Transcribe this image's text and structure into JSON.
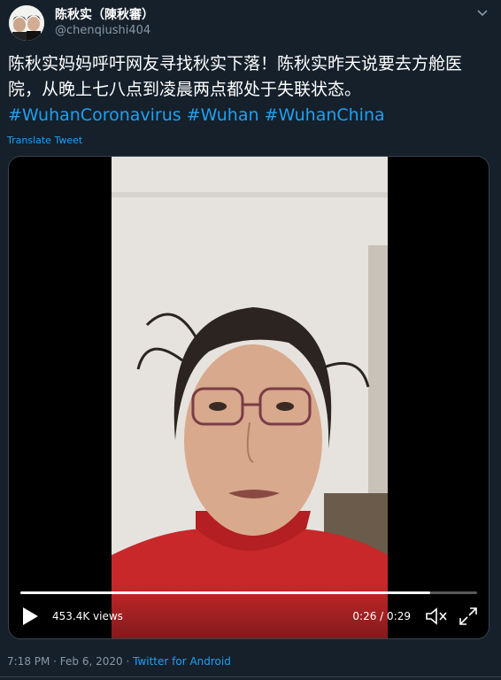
{
  "tweet": {
    "display_name": "陈秋实（陳秋審）",
    "handle": "@chenqiushi404",
    "text": "陈秋实妈妈呼吁网友寻找秋实下落！陈秋实昨天说要去方舱医院，从晚上七八点到凌晨两点都处于失联状态。",
    "hashtags": [
      "#WuhanCoronavirus",
      "#Wuhan",
      "#WuhanChina"
    ],
    "translate_label": "Translate Tweet"
  },
  "video": {
    "views": "453.4K views",
    "time": "0:26 / 0:29",
    "progress_fraction": 0.897
  },
  "footer": {
    "timestamp": "7:18 PM · Feb 6, 2020 · ",
    "source": "Twitter for Android"
  },
  "colors": {
    "background": "#15202b",
    "accent": "#1da1f2",
    "secondary_text": "#8899a6"
  }
}
